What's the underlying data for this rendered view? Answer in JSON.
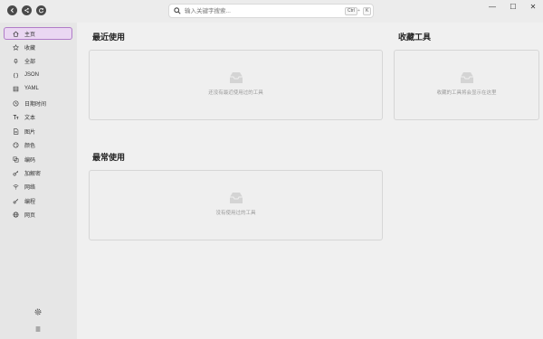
{
  "search": {
    "placeholder": "输入关键字搜索...",
    "kbd_ctrl": "Ctrl",
    "kbd_plus": "+",
    "kbd_k": "K"
  },
  "window": {
    "minimize": "—",
    "maximize": "☐",
    "close": "✕"
  },
  "sidebar": {
    "items": [
      {
        "label": "主页",
        "icon": "home-icon",
        "active": true
      },
      {
        "label": "收藏",
        "icon": "star-icon"
      },
      {
        "label": "全部",
        "icon": "bell-icon"
      },
      {
        "label": "JSON",
        "icon": "braces-icon"
      },
      {
        "label": "YAML",
        "icon": "grid-icon"
      },
      {
        "label": "日期时间",
        "icon": "clock-icon"
      },
      {
        "label": "文本",
        "icon": "text-icon"
      },
      {
        "label": "图片",
        "icon": "image-icon"
      },
      {
        "label": "颜色",
        "icon": "palette-icon"
      },
      {
        "label": "编码",
        "icon": "copy-icon"
      },
      {
        "label": "加解密",
        "icon": "key-icon"
      },
      {
        "label": "网络",
        "icon": "wifi-icon"
      },
      {
        "label": "编程",
        "icon": "code-icon"
      },
      {
        "label": "网页",
        "icon": "globe-icon"
      }
    ]
  },
  "main": {
    "recent_title": "最近使用",
    "recent_empty": "还没有最近使用过的工具",
    "favorites_title": "收藏工具",
    "favorites_empty": "收藏的工具将会显示在这里",
    "frequent_title": "最常使用",
    "frequent_empty": "没有使用过的工具"
  },
  "colors": {
    "accent": "#b07cc8",
    "accent_bg": "#ead7f2"
  }
}
